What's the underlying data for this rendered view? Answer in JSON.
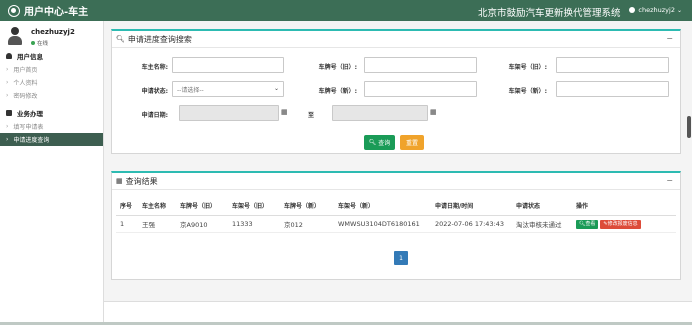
{
  "header": {
    "brand": "用户中心-车主",
    "system_title": "北京市鼓励汽车更新换代管理系统",
    "user": "chezhuzyj2"
  },
  "sidebar": {
    "username": "chezhuzyj2",
    "status": "在线",
    "sections": [
      {
        "title": "用户信息",
        "items": [
          "用户首页",
          "个人资料",
          "密码修改"
        ]
      },
      {
        "title": "业务办理",
        "items": [
          "填写申请表",
          "申请进度查询"
        ]
      }
    ],
    "active_item": "申请进度查询"
  },
  "search": {
    "title": "申请进度查询搜索",
    "labels": {
      "owner_name": "车主名称:",
      "plate_old": "车牌号（旧）:",
      "frame_old": "车架号（旧）:",
      "status": "申请状态:",
      "plate_new": "车牌号（新）:",
      "frame_new": "车架号（新）:",
      "date": "申请日期:",
      "to": "至"
    },
    "status_placeholder": "--请选择--",
    "query_button": "查询",
    "reset_button": "重置"
  },
  "results": {
    "title": "查询结果",
    "columns": [
      "序号",
      "车主名称",
      "车牌号（旧）",
      "车架号（旧）",
      "车牌号（新）",
      "车架号（新）",
      "申请日期/时间",
      "申请状态",
      "操作"
    ],
    "rows": [
      {
        "index": "1",
        "owner": "王强",
        "plate_old": "京A9010",
        "frame_old": "11333",
        "plate_new": "京012",
        "frame_new": "WMWSU3104DT6180161",
        "datetime": "2022-07-06 17:43:43",
        "status": "淘汰审核未通过",
        "view": "查看",
        "edit": "修改报废信息"
      }
    ],
    "page": "1"
  },
  "colors": {
    "header": "#3c6e56",
    "active_menu": "#3d5e50",
    "box_accent": "#2dbbb2",
    "primary_green": "#1a9b57",
    "reset_orange": "#f0a32b",
    "pager_blue": "#337ab7"
  }
}
